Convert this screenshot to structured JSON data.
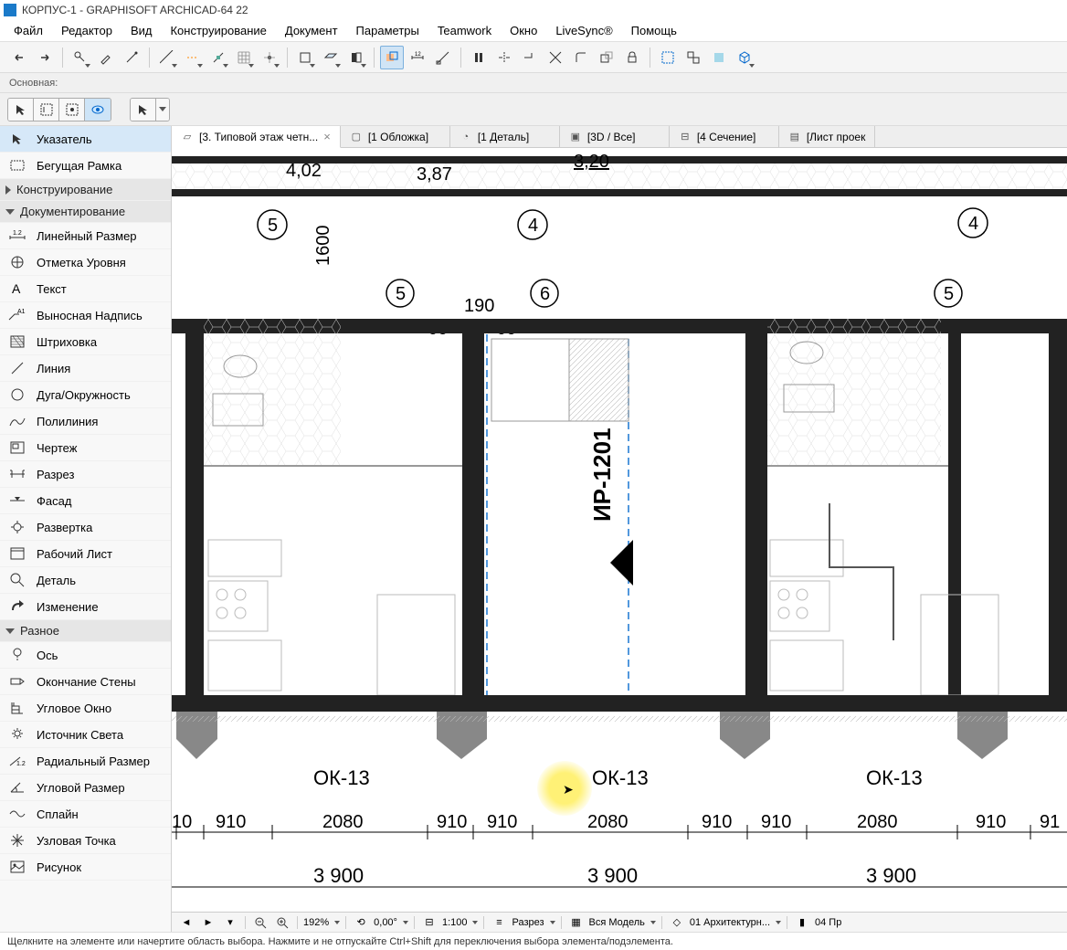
{
  "titlebar": {
    "title": "КОРПУС-1 - GRAPHISOFT ARCHICAD-64 22"
  },
  "menubar": [
    "Файл",
    "Редактор",
    "Вид",
    "Конструирование",
    "Документ",
    "Параметры",
    "Teamwork",
    "Окно",
    "LiveSync®",
    "Помощь"
  ],
  "infobar_label": "Основная:",
  "tabs": [
    {
      "label": "[3. Типовой этаж четн...",
      "active": true,
      "close": "×"
    },
    {
      "label": "[1 Обложка]"
    },
    {
      "label": "[1 Деталь]"
    },
    {
      "label": "[3D / Все]"
    },
    {
      "label": "[4 Сечение]"
    },
    {
      "label": "[Лист проек"
    }
  ],
  "toolbox": {
    "selection": [
      {
        "label": "Указатель",
        "selected": true
      },
      {
        "label": "Бегущая Рамка"
      }
    ],
    "header_construct": "Конструирование",
    "header_document": "Документирование",
    "document": [
      {
        "label": "Линейный Размер"
      },
      {
        "label": "Отметка Уровня"
      },
      {
        "label": "Текст"
      },
      {
        "label": "Выносная Надпись"
      },
      {
        "label": "Штриховка"
      },
      {
        "label": "Линия"
      },
      {
        "label": "Дуга/Окружность"
      },
      {
        "label": "Полилиния"
      },
      {
        "label": "Чертеж"
      },
      {
        "label": "Разрез"
      },
      {
        "label": "Фасад"
      },
      {
        "label": "Развертка"
      },
      {
        "label": "Рабочий Лист"
      },
      {
        "label": "Деталь"
      },
      {
        "label": "Изменение"
      }
    ],
    "header_misc": "Разное",
    "misc": [
      {
        "label": "Ось"
      },
      {
        "label": "Окончание Стены"
      },
      {
        "label": "Угловое Окно"
      },
      {
        "label": "Источник Света"
      },
      {
        "label": "Радиальный Размер"
      },
      {
        "label": "Угловой Размер"
      },
      {
        "label": "Сплайн"
      },
      {
        "label": "Узловая Точка"
      },
      {
        "label": "Рисунок"
      }
    ]
  },
  "drawing": {
    "axes_top": [
      "5",
      "4",
      "4"
    ],
    "axes_mid": [
      "5",
      "6",
      "5"
    ],
    "dims_top": [
      "4,02",
      "3,87",
      "3,20"
    ],
    "dim_1600": "1600",
    "dim_190": "190",
    "dim_60": "60",
    "dim_60b": "60",
    "marker": "ИР-1201",
    "windows": [
      "ОК-13",
      "ОК-13",
      "ОК-13"
    ],
    "dims_bottom1": [
      "10",
      "910",
      "2080",
      "910",
      "910",
      "2080",
      "910",
      "910",
      "2080",
      "910",
      "91"
    ],
    "dims_bottom2": [
      "3 900",
      "3 900",
      "3 900"
    ]
  },
  "quickbar": {
    "zoom": "192%",
    "angle": "0,00°",
    "scale": "1:100",
    "type": "Разрез",
    "model": "Вся Модель",
    "layer": "01 Архитектурн...",
    "pen": "04 Пр"
  },
  "statusbar": "Щелкните на элементе или начертите область выбора. Нажмите и не отпускайте Ctrl+Shift для переключения выбора элемента/подэлемента."
}
